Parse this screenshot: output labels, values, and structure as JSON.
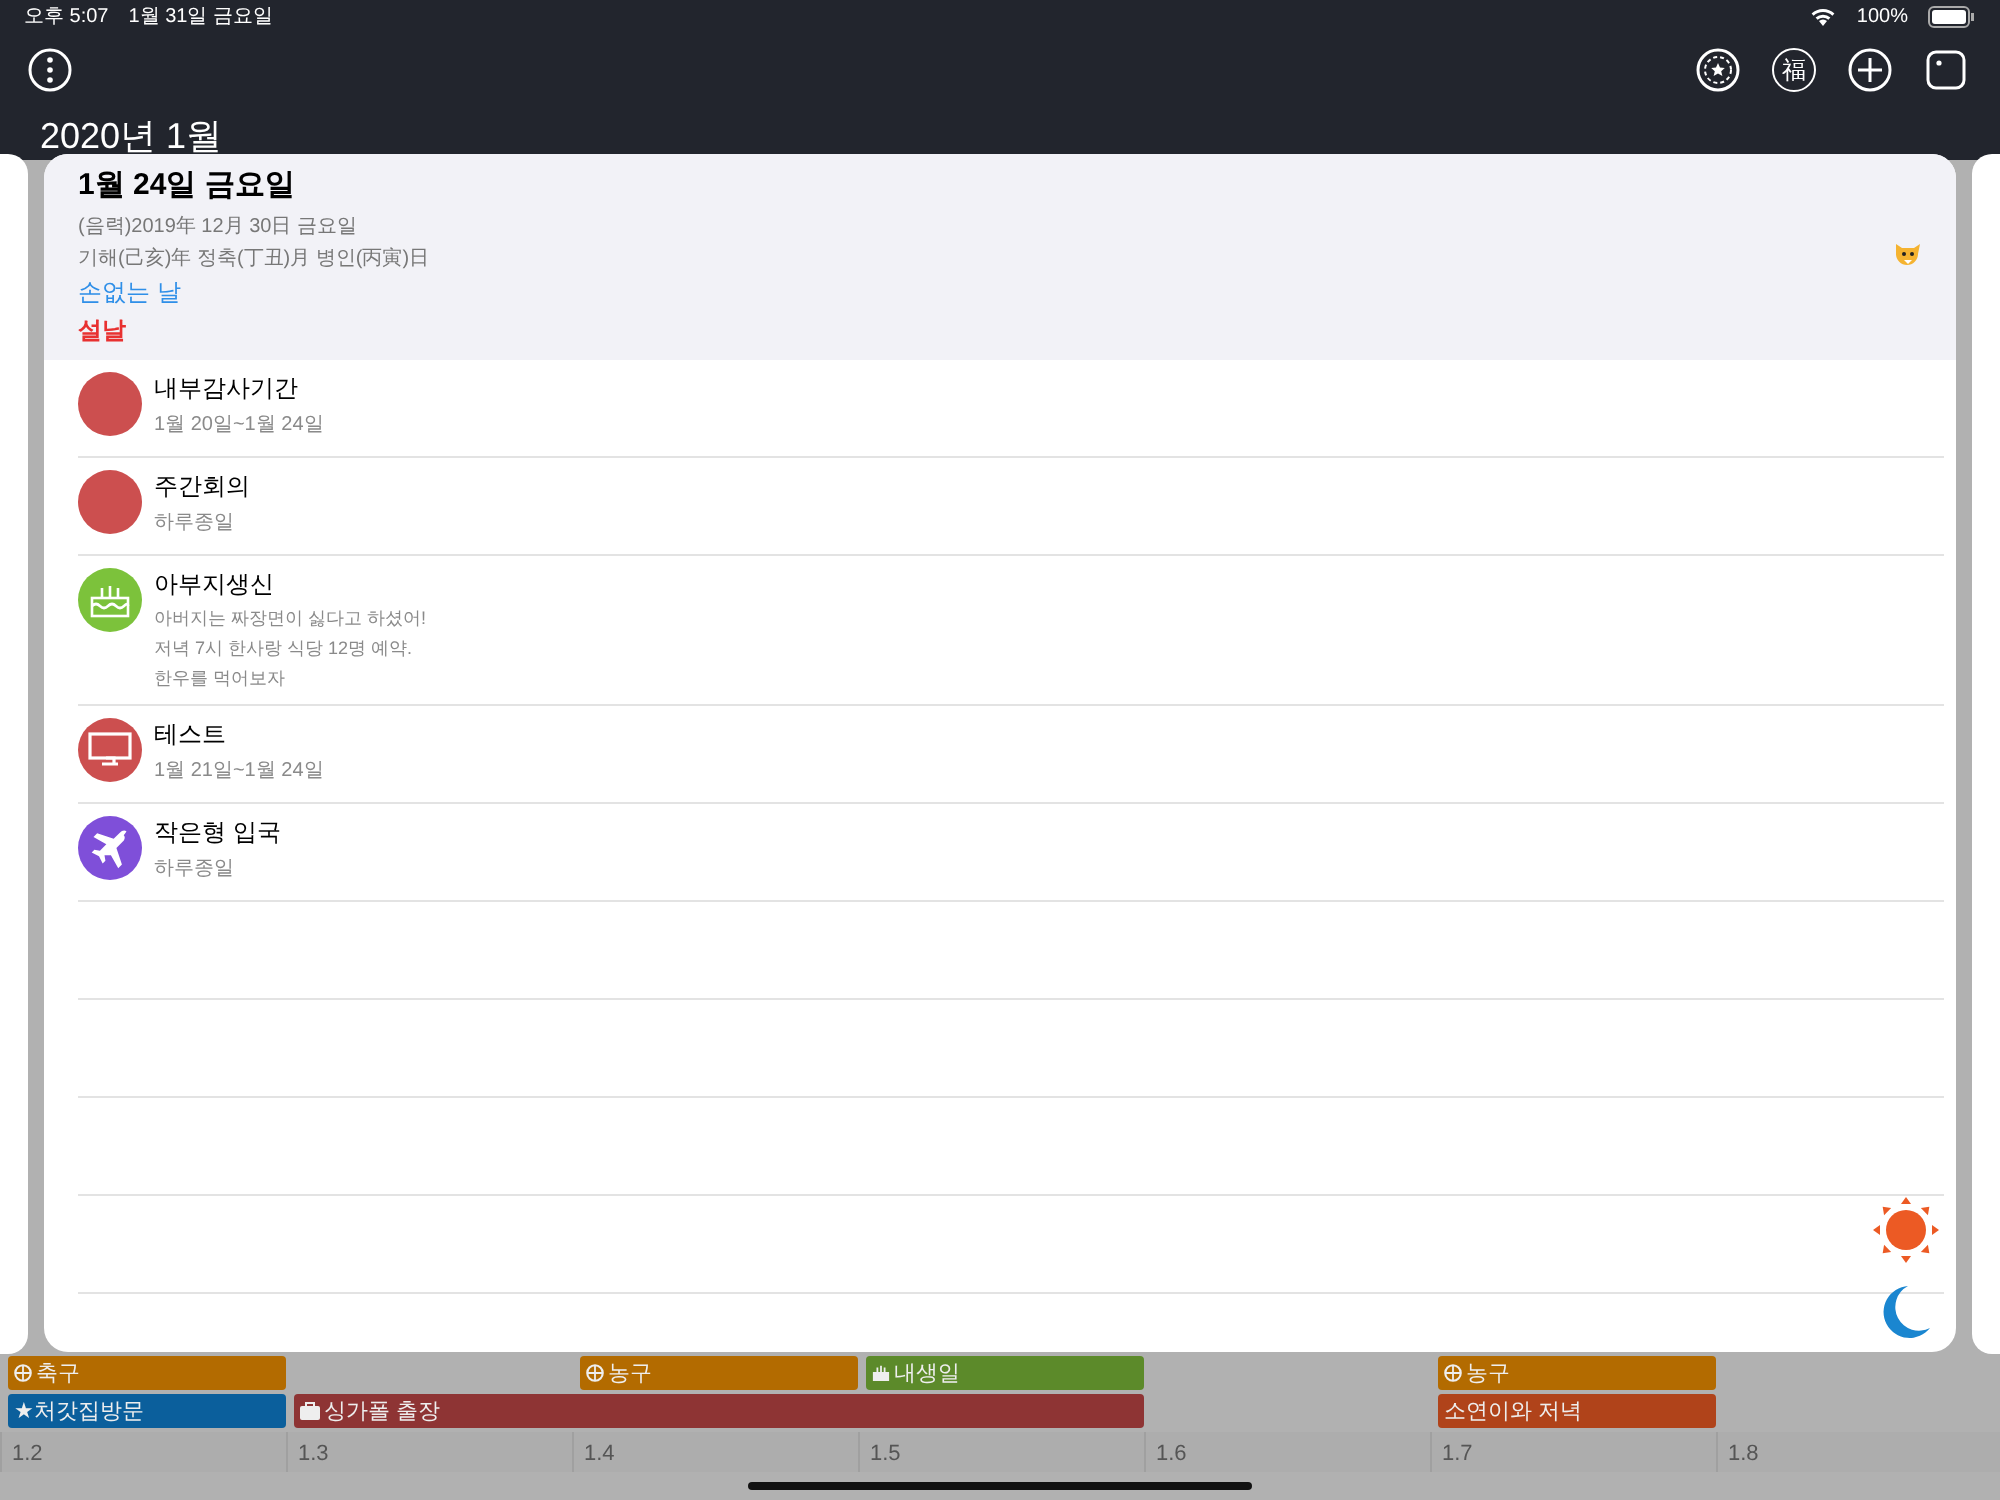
{
  "status_bar": {
    "time": "오후 5:07",
    "date": "1월 31일 금요일",
    "battery": "100%"
  },
  "toolbar": {
    "fortune_label": "福"
  },
  "month_title": "2020년 1월",
  "day_card": {
    "title": "1월 24일 금요일",
    "lunar": "(음력)2019年 12月 30日 금요일",
    "ganji": "기해(己亥)年 정축(丁丑)月 병인(丙寅)日",
    "lucky_day": "손없는 날",
    "holiday": "설날",
    "events": [
      {
        "title": "내부감사기간",
        "lines": [
          "1월 20일~1월 24일"
        ],
        "kind": "dot",
        "color": "#cc4f4f"
      },
      {
        "title": "주간회의",
        "lines": [
          "하루종일"
        ],
        "kind": "dot",
        "color": "#cc4f4f"
      },
      {
        "title": "아부지생신",
        "lines": [
          "아버지는 짜장면이 싫다고 하셨어!",
          "저녁 7시 한사랑 식당 12명 예약.",
          "한우를 먹어보자"
        ],
        "kind": "cake",
        "color": "#7cc23b"
      },
      {
        "title": "테스트",
        "lines": [
          "1월 21일~1월 24일"
        ],
        "kind": "monitor",
        "color": "#cc4f4f"
      },
      {
        "title": "작은형 입국",
        "lines": [
          "하루종일"
        ],
        "kind": "plane",
        "color": "#7f4fd9"
      }
    ]
  },
  "week": {
    "days": [
      "1.2",
      "1.3",
      "1.4",
      "1.5",
      "1.6",
      "1.7",
      "1.8"
    ],
    "events": [
      {
        "label": "축구",
        "kind": "ball",
        "color": "#b36b00"
      },
      {
        "label": "농구",
        "kind": "ball",
        "color": "#b36b00"
      },
      {
        "label": "내생일",
        "kind": "cake",
        "color": "#5c8a2a"
      },
      {
        "label": "농구",
        "kind": "ball",
        "color": "#b36b00"
      },
      {
        "label": "★처갓집방문",
        "kind": "plain",
        "color": "#0b5f9c"
      },
      {
        "label": "싱가폴 출장",
        "kind": "bag",
        "color": "#8e3434"
      },
      {
        "label": "소연이와 저녁",
        "kind": "plain",
        "color": "#b0431a"
      }
    ]
  }
}
